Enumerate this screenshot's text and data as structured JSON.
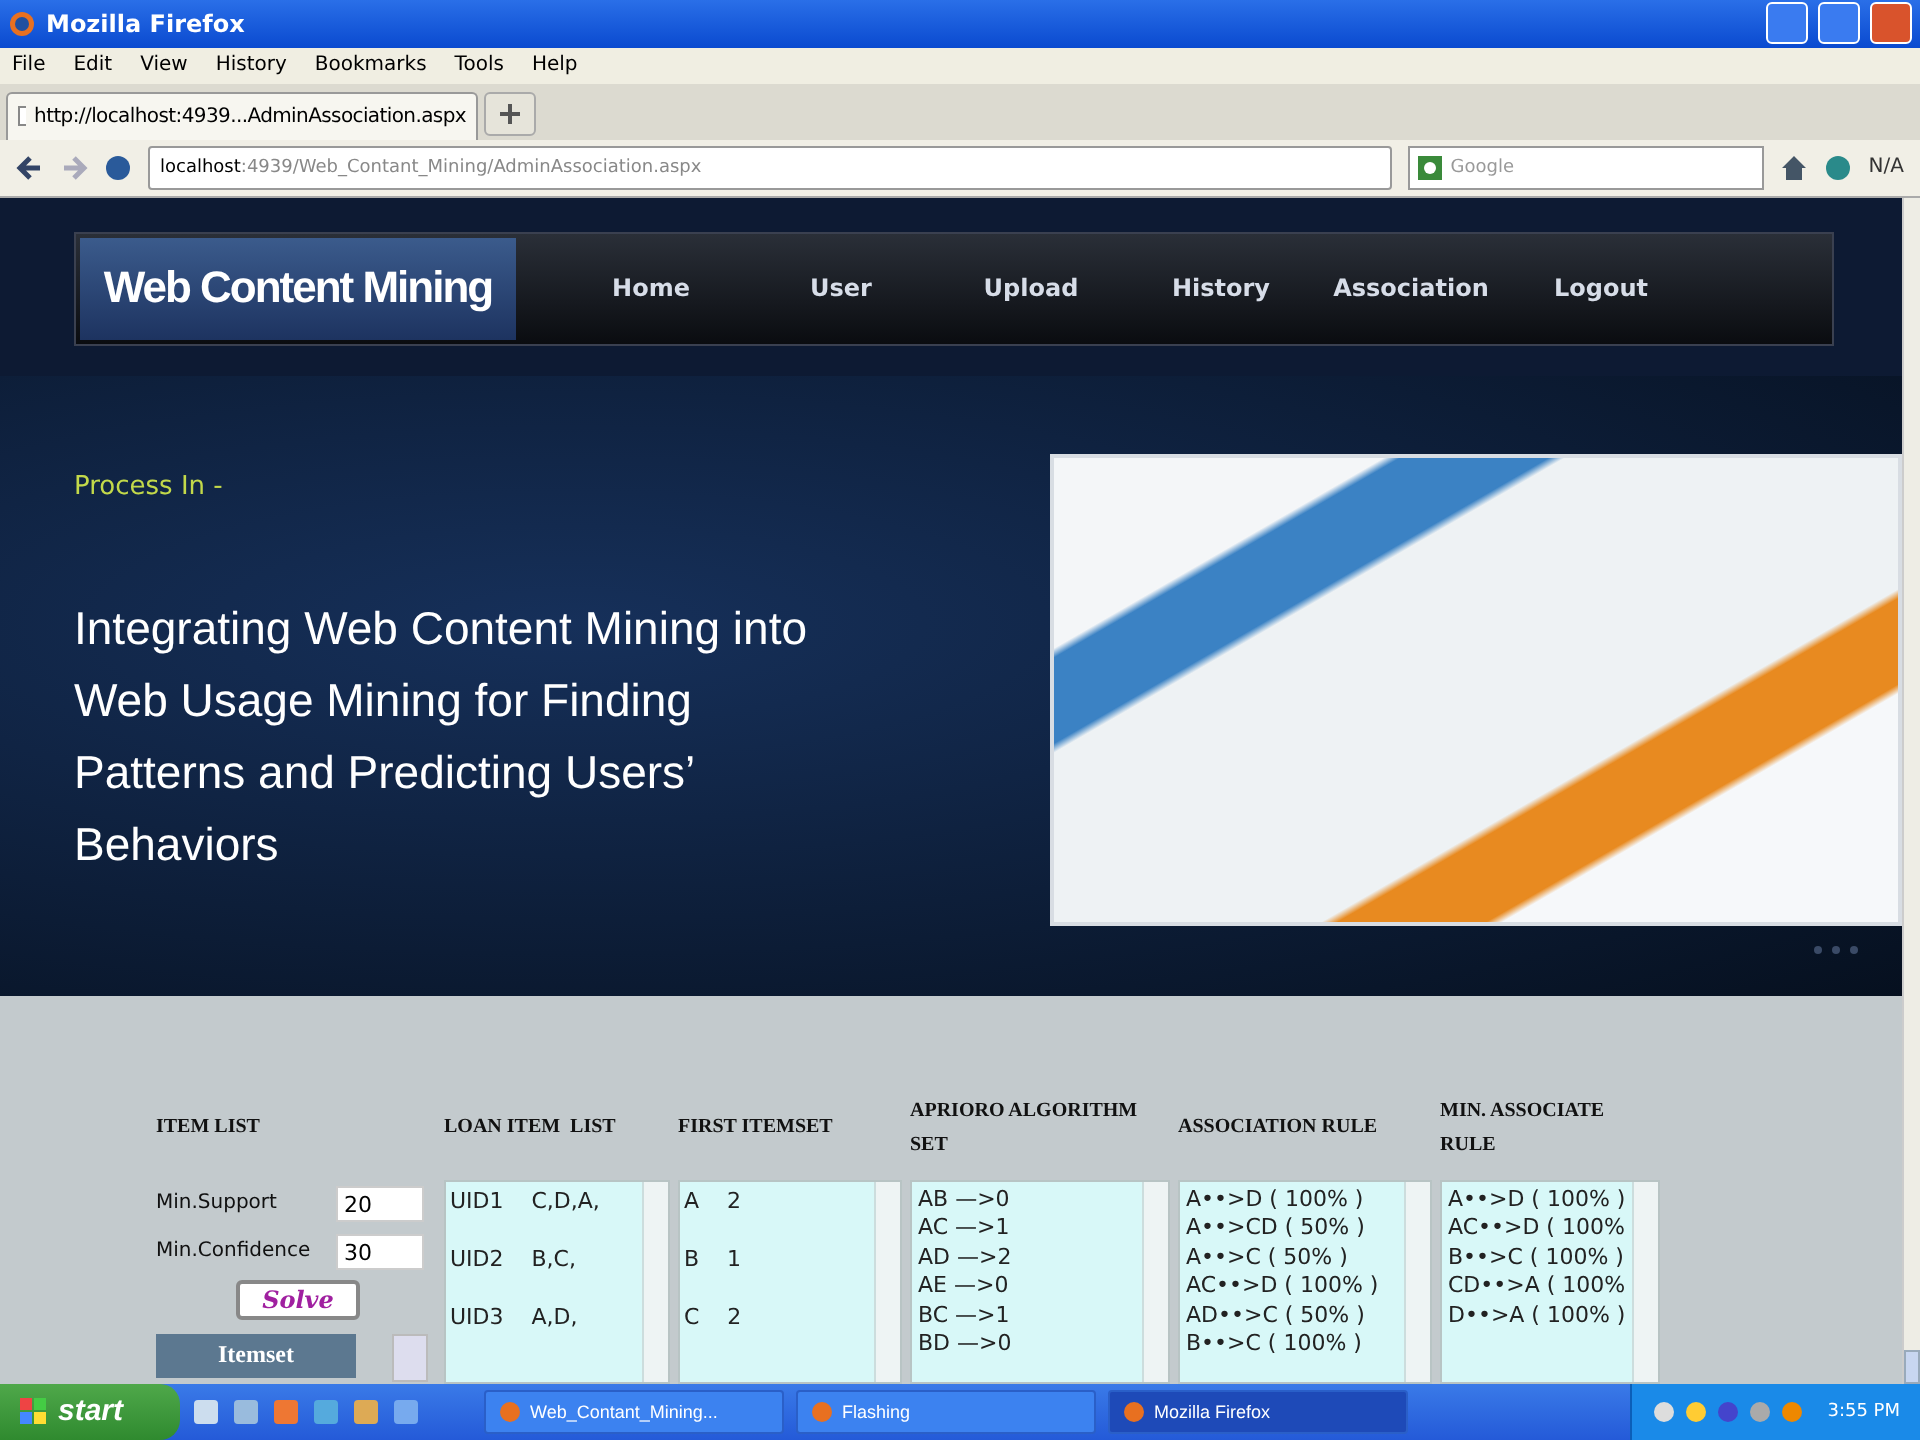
{
  "window": {
    "title": "Mozilla Firefox"
  },
  "menu": [
    "File",
    "Edit",
    "View",
    "History",
    "Bookmarks",
    "Tools",
    "Help"
  ],
  "tabs": [
    {
      "label": "http://localhost:4939...AdminAssociation.aspx",
      "selected": true
    }
  ],
  "navbar": {
    "url_host": "localhost",
    "url_path": ":4939/Web_Contant_Mining/AdminAssociation.aspx",
    "search_placeholder": "Google",
    "addon_label": "N/A"
  },
  "site": {
    "logo": "Web Content Mining",
    "nav": [
      "Home",
      "User",
      "Upload",
      "History",
      "Association",
      "Logout"
    ],
    "process_label": "Process In -",
    "headline": "Integrating Web Content Mining into Web Usage Mining for Finding Patterns and Predicting Users’ Behaviors"
  },
  "analysis": {
    "item_list_heading": "ITEM LIST",
    "fields": [
      {
        "label": "Min.Support",
        "value": "20"
      },
      {
        "label": "Min.Confidence",
        "value": "30"
      }
    ],
    "solve_button": "Solve",
    "itemset_button": "Itemset",
    "columns": [
      {
        "heading": "LOAN ITEM  LIST",
        "kind": "spaced",
        "lines": [
          "UID1    C,D,A,",
          "UID2    B,C,",
          "UID3    A,D,"
        ]
      },
      {
        "heading": "FIRST ITEMSET",
        "kind": "spaced",
        "lines": [
          "A    2",
          "B    1",
          "C    2"
        ]
      },
      {
        "heading": "APRIORO ALGORITHM SET",
        "kind": "dense",
        "lines": [
          "AB —>0",
          "AC —>1",
          "AD —>2",
          "AE —>0",
          "BC —>1",
          "BD —>0"
        ]
      },
      {
        "heading": "ASSOCIATION RULE",
        "kind": "dense",
        "lines": [
          "A••>D ( 100% )",
          "A••>CD ( 50% )",
          "A••>C ( 50% )",
          "AC••>D ( 100% )",
          "AD••>C ( 50% )",
          "B••>C ( 100% )"
        ]
      },
      {
        "heading": "MIN. ASSOCIATE RULE",
        "kind": "dense",
        "lines": [
          "A••>D ( 100% )",
          "AC••>D ( 100%",
          "B••>C ( 100% )",
          "CD••>A ( 100%",
          "D••>A ( 100% )"
        ]
      }
    ]
  },
  "taskbar": {
    "start": "start",
    "tasks": [
      {
        "label": "Web_Contant_Mining...",
        "selected": false
      },
      {
        "label": "Flashing",
        "selected": false
      },
      {
        "label": "Mozilla Firefox",
        "selected": true
      }
    ],
    "clock": "3:55 PM"
  }
}
